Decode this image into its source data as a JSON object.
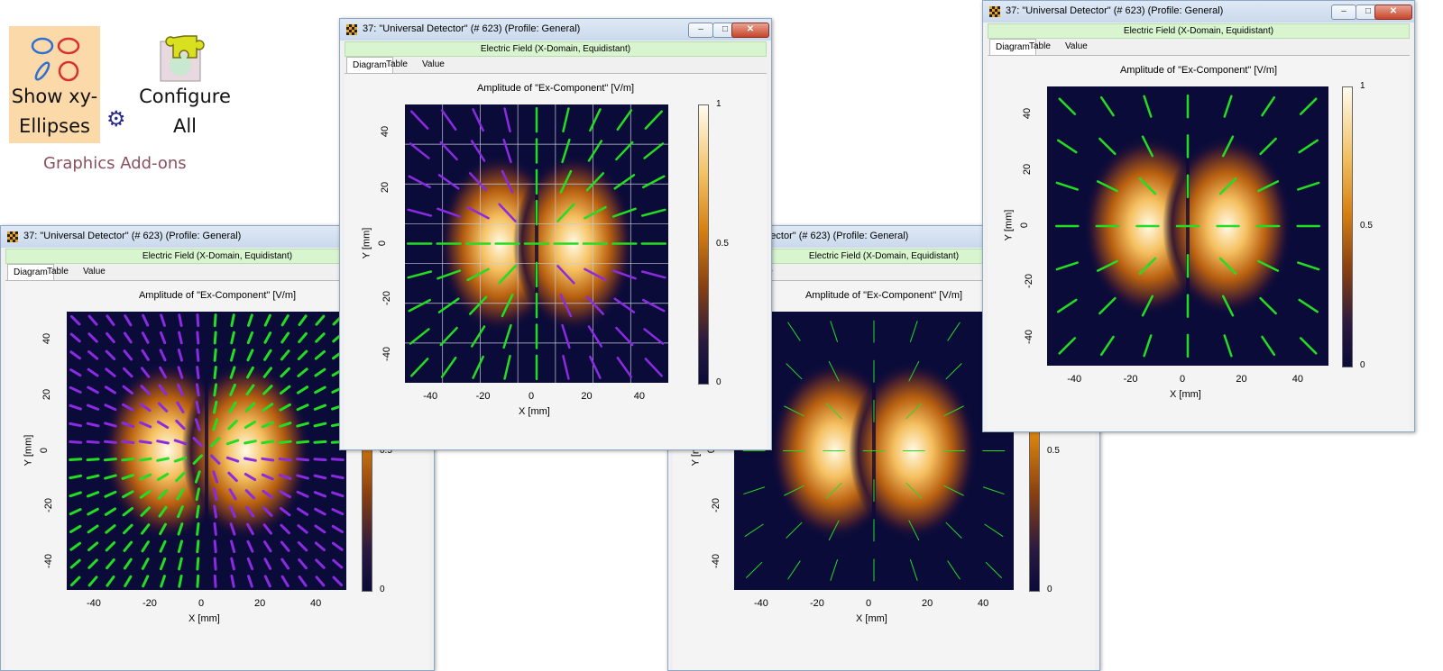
{
  "ribbon": {
    "show_ellipses_line1": "Show xy-",
    "show_ellipses_line2": "Ellipses",
    "configure_line1": "Configure",
    "configure_line2": "All",
    "group_label": "Graphics Add-ons",
    "icons": [
      "ellipses-icon",
      "puzzle-icon",
      "settings-icon"
    ]
  },
  "window": {
    "title": "37: \"Universal Detector\" (# 623) (Profile: General)",
    "subtitle": "Electric Field (X-Domain, Equidistant)",
    "tabs": [
      "Diagram",
      "Table",
      "Value at (x,y)"
    ],
    "plot_title": "Amplitude of \"Ex-Component\"  [V/m]",
    "xlabel": "X [mm]",
    "ylabel": "Y [mm]",
    "ticks": [
      "-40",
      "-20",
      "0",
      "20",
      "40"
    ],
    "cbar_labels": [
      "1",
      "0.5",
      "0"
    ]
  },
  "colors": {
    "purple": "#8a2be2",
    "green": "#22dd22",
    "title_green": "#d9f5d0"
  },
  "chart_data": [
    {
      "type": "heatmap",
      "panel": "bottom-left",
      "xlim": [
        -50,
        50
      ],
      "ylim": [
        -50,
        50
      ],
      "colorbar": [
        0,
        1
      ],
      "overlay": "polarization lines (purple and green)"
    },
    {
      "type": "heatmap",
      "panel": "center",
      "xlim": [
        -50,
        50
      ],
      "ylim": [
        -50,
        50
      ],
      "colorbar": [
        0,
        1
      ],
      "overlay": "polarization lines with grid"
    },
    {
      "type": "heatmap",
      "panel": "bottom-right",
      "xlim": [
        -50,
        50
      ],
      "ylim": [
        -50,
        50
      ],
      "colorbar": [
        0,
        1
      ],
      "overlay": "thin green polarization lines"
    },
    {
      "type": "heatmap",
      "panel": "top-right",
      "xlim": [
        -50,
        50
      ],
      "ylim": [
        -50,
        50
      ],
      "colorbar": [
        0,
        1
      ],
      "overlay": "green polarization lines"
    }
  ]
}
